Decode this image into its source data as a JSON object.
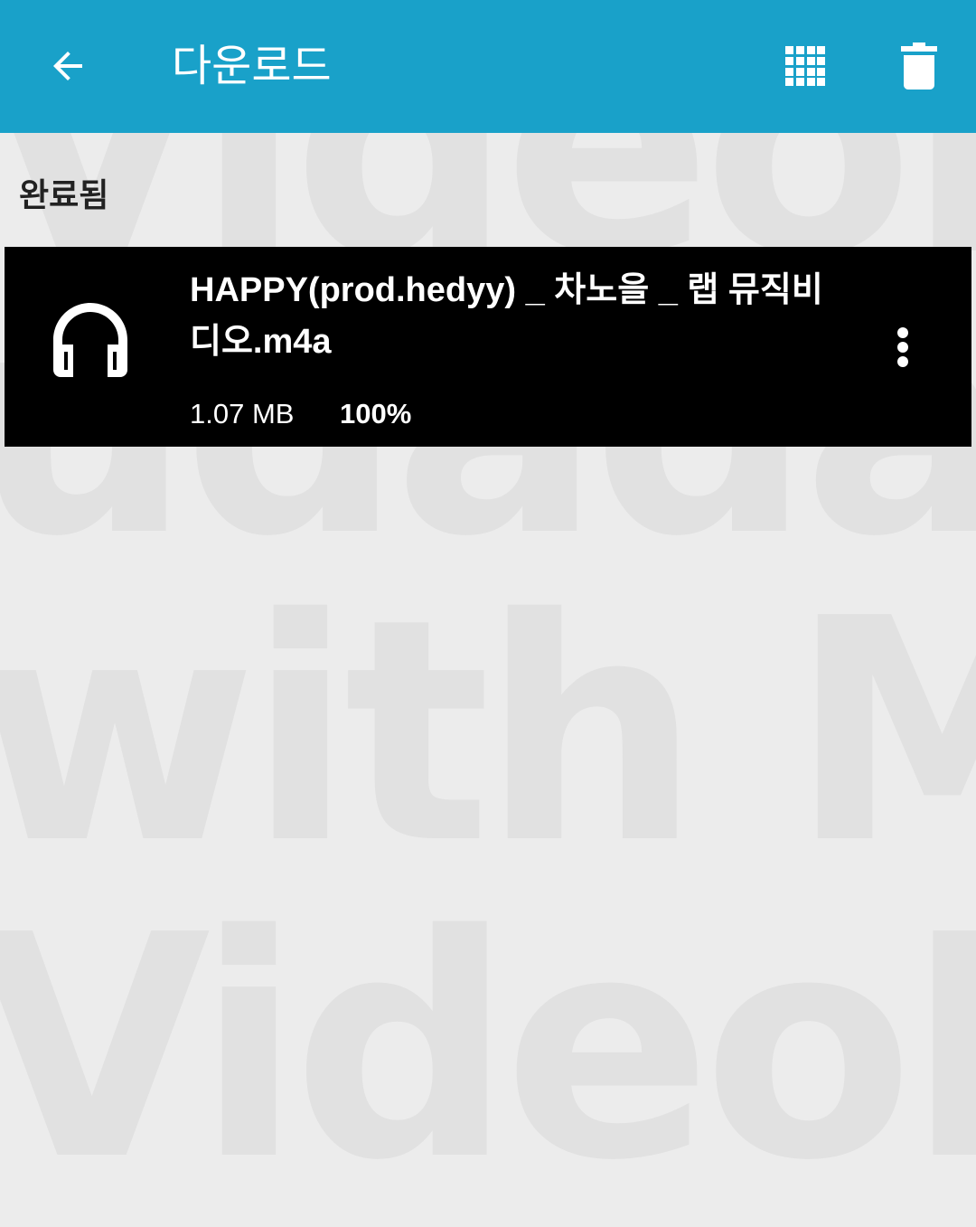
{
  "appbar": {
    "title": "다운로드",
    "back_icon": "arrow-back-icon",
    "grid_icon": "grid-view-icon",
    "delete_icon": "trash-icon",
    "background_color": "#19a1c9"
  },
  "watermark": {
    "lines": [
      "VideoPla",
      "udadam V",
      "with Mo",
      "VideoPla"
    ]
  },
  "section": {
    "label": "완료됨"
  },
  "downloads": [
    {
      "icon": "headphones-icon",
      "title": "HAPPY(prod.hedyy) _  차노을 _ 랩 뮤직비디오.m4a",
      "size": "1.07 MB",
      "progress": "100%",
      "menu_icon": "more-vert-icon"
    }
  ]
}
